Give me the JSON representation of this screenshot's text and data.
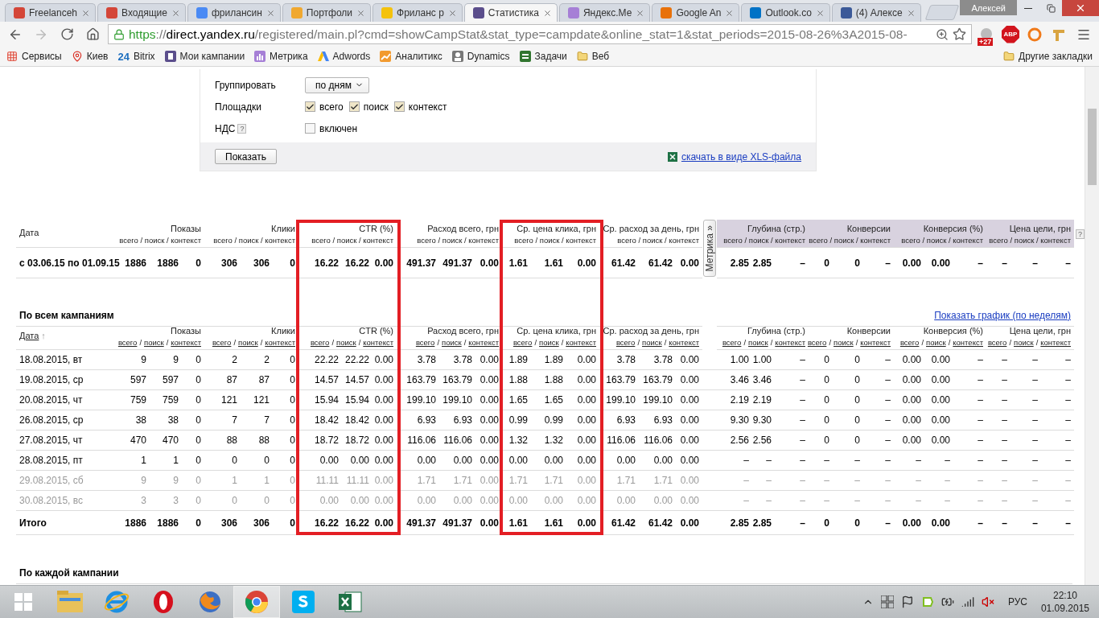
{
  "browser": {
    "tabs": [
      {
        "title": "Freelanceh",
        "selected": false,
        "color": "#d44638"
      },
      {
        "title": "Входящие",
        "selected": false,
        "color": "#d44638"
      },
      {
        "title": "фрилансин",
        "selected": false,
        "color": "#4a8af4"
      },
      {
        "title": "Портфоли",
        "selected": false,
        "color": "#f0a830"
      },
      {
        "title": "Фриланс р",
        "selected": false,
        "color": "#f4c20d"
      },
      {
        "title": "Статистика",
        "selected": true,
        "color": "#5b4e8c"
      },
      {
        "title": "Яндекс.Ме",
        "selected": false,
        "color": "#a67fd6"
      },
      {
        "title": "Google An",
        "selected": false,
        "color": "#e8710a"
      },
      {
        "title": "Outlook.co",
        "selected": false,
        "color": "#0072c6"
      },
      {
        "title": "(4) Алексе",
        "selected": false,
        "color": "#3b5998"
      }
    ],
    "user": "Алексей",
    "address": {
      "scheme": "https",
      "separator": "://",
      "host": "direct.yandex.ru",
      "path": "/registered/main.pl?cmd=showCampStat&stat_type=campdate&online_stat=1&stat_periods=2015-08-26%3A2015-08-"
    },
    "extension_badge": "+27",
    "abp": "ABP",
    "bookmarks": [
      {
        "kind": "apps",
        "label": "Сервисы"
      },
      {
        "kind": "pin",
        "label": "Киев"
      },
      {
        "kind": "bitrix",
        "icon_text": "24",
        "label": "Bitrix"
      },
      {
        "kind": "campaigns",
        "label": "Мои кампании"
      },
      {
        "kind": "metrika",
        "label": "Метрика"
      },
      {
        "kind": "adwords",
        "label": "Adwords"
      },
      {
        "kind": "analytics",
        "label": "Аналитикс"
      },
      {
        "kind": "dynamics",
        "label": "Dynamics"
      },
      {
        "kind": "tasks",
        "label": "Задачи"
      },
      {
        "kind": "folder",
        "label": "Веб"
      }
    ],
    "other_bookmarks": "Другие закладки"
  },
  "form": {
    "rows": [
      {
        "kind": "select",
        "label": "Группировать",
        "value": "по дням"
      },
      {
        "kind": "checkboxes",
        "label": "Площадки",
        "options": [
          {
            "label": "всего",
            "checked": true
          },
          {
            "label": "поиск",
            "checked": true
          },
          {
            "label": "контекст",
            "checked": true
          }
        ]
      },
      {
        "kind": "checkboxes",
        "label": "НДС",
        "help": "?",
        "options": [
          {
            "label": "включен",
            "checked": false
          }
        ]
      }
    ],
    "submit": "Показать",
    "download": "скачать в виде XLS-файла"
  },
  "stats": {
    "summary": {
      "date_heading": "Дата",
      "metrika_tab": "Метрика »",
      "help": "?",
      "columns": [
        {
          "title": "Показы",
          "subtitle": "всего / поиск / контекст",
          "shaded": false
        },
        {
          "title": "Клики",
          "subtitle": "всего / поиск / контекст",
          "shaded": false
        },
        {
          "title": "CTR (%)",
          "subtitle": "всего / поиск / контекст",
          "shaded": false
        },
        {
          "title": "Расход всего, грн",
          "subtitle": "всего / поиск / контекст",
          "shaded": false
        },
        {
          "title": "Ср. цена клика, грн",
          "subtitle": "всего / поиск / контекст",
          "shaded": false
        },
        {
          "title": "Ср. расход за день, грн",
          "subtitle": "всего / поиск / контекст",
          "shaded": false
        },
        {
          "title": "Глубина (стр.)",
          "subtitle": "всего / поиск / контекст",
          "shaded": true
        },
        {
          "title": "Конверсии",
          "subtitle": "всего / поиск / контекст",
          "shaded": true
        },
        {
          "title": "Конверсия (%)",
          "subtitle": "всего / поиск / контекст",
          "shaded": true
        },
        {
          "title": "Цена цели, грн",
          "subtitle": "всего / поиск / контекст",
          "shaded": true
        }
      ],
      "row": {
        "date": "с 03.06.15 по 01.09.15",
        "values": [
          "1886",
          "1886",
          "0",
          "306",
          "306",
          "0",
          "16.22",
          "16.22",
          "0.00",
          "491.37",
          "491.37",
          "0.00",
          "1.61",
          "1.61",
          "0.00",
          "61.42",
          "61.42",
          "0.00",
          "2.85",
          "2.85",
          "–",
          "0",
          "0",
          "–",
          "0.00",
          "0.00",
          "–",
          "–",
          "–",
          "–"
        ]
      }
    },
    "all_campaigns": {
      "title": "По всем кампаниям",
      "chart_link": "Показать график (по неделям)",
      "date_heading": "Дата",
      "sort_arrow": "↑",
      "separator": "/",
      "columns": [
        {
          "title": "Показы",
          "sub": [
            "всего",
            "поиск",
            "контекст"
          ],
          "outlined": false
        },
        {
          "title": "Клики",
          "sub": [
            "всего",
            "поиск",
            "контекст"
          ],
          "outlined": false
        },
        {
          "title": "CTR (%)",
          "sub": [
            "всего",
            "поиск",
            "контекст"
          ],
          "outlined": true
        },
        {
          "title": "Расход всего, грн",
          "sub": [
            "всего",
            "поиск",
            "контекст"
          ],
          "outlined": false
        },
        {
          "title": "Ср. цена клика, грн",
          "sub": [
            "всего",
            "поиск",
            "контекст"
          ],
          "outlined": true
        },
        {
          "title": "Ср. расход за день, грн",
          "sub": [
            "всего",
            "поиск",
            "контекст"
          ],
          "outlined": false
        },
        {
          "title": "Глубина (стр.)",
          "sub": [
            "всего",
            "поиск",
            "контекст"
          ],
          "outlined": false
        },
        {
          "title": "Конверсии",
          "sub": [
            "всего",
            "поиск",
            "контекст"
          ],
          "outlined": false
        },
        {
          "title": "Конверсия (%)",
          "sub": [
            "всего",
            "поиск",
            "контекст"
          ],
          "outlined": false
        },
        {
          "title": "Цена цели, грн",
          "sub": [
            "всего",
            "поиск",
            "контекст"
          ],
          "outlined": false
        }
      ],
      "rows": [
        {
          "date": "18.08.2015, вт",
          "dimmed": false,
          "values": [
            "9",
            "9",
            "0",
            "2",
            "2",
            "0",
            "22.22",
            "22.22",
            "0.00",
            "3.78",
            "3.78",
            "0.00",
            "1.89",
            "1.89",
            "0.00",
            "3.78",
            "3.78",
            "0.00",
            "1.00",
            "1.00",
            "–",
            "0",
            "0",
            "–",
            "0.00",
            "0.00",
            "–",
            "–",
            "–",
            "–"
          ]
        },
        {
          "date": "19.08.2015, ср",
          "dimmed": false,
          "values": [
            "597",
            "597",
            "0",
            "87",
            "87",
            "0",
            "14.57",
            "14.57",
            "0.00",
            "163.79",
            "163.79",
            "0.00",
            "1.88",
            "1.88",
            "0.00",
            "163.79",
            "163.79",
            "0.00",
            "3.46",
            "3.46",
            "–",
            "0",
            "0",
            "–",
            "0.00",
            "0.00",
            "–",
            "–",
            "–",
            "–"
          ]
        },
        {
          "date": "20.08.2015, чт",
          "dimmed": false,
          "values": [
            "759",
            "759",
            "0",
            "121",
            "121",
            "0",
            "15.94",
            "15.94",
            "0.00",
            "199.10",
            "199.10",
            "0.00",
            "1.65",
            "1.65",
            "0.00",
            "199.10",
            "199.10",
            "0.00",
            "2.19",
            "2.19",
            "–",
            "0",
            "0",
            "–",
            "0.00",
            "0.00",
            "–",
            "–",
            "–",
            "–"
          ]
        },
        {
          "date": "26.08.2015, ср",
          "dimmed": false,
          "values": [
            "38",
            "38",
            "0",
            "7",
            "7",
            "0",
            "18.42",
            "18.42",
            "0.00",
            "6.93",
            "6.93",
            "0.00",
            "0.99",
            "0.99",
            "0.00",
            "6.93",
            "6.93",
            "0.00",
            "9.30",
            "9.30",
            "–",
            "0",
            "0",
            "–",
            "0.00",
            "0.00",
            "–",
            "–",
            "–",
            "–"
          ]
        },
        {
          "date": "27.08.2015, чт",
          "dimmed": false,
          "values": [
            "470",
            "470",
            "0",
            "88",
            "88",
            "0",
            "18.72",
            "18.72",
            "0.00",
            "116.06",
            "116.06",
            "0.00",
            "1.32",
            "1.32",
            "0.00",
            "116.06",
            "116.06",
            "0.00",
            "2.56",
            "2.56",
            "–",
            "0",
            "0",
            "–",
            "0.00",
            "0.00",
            "–",
            "–",
            "–",
            "–"
          ]
        },
        {
          "date": "28.08.2015, пт",
          "dimmed": false,
          "values": [
            "1",
            "1",
            "0",
            "0",
            "0",
            "0",
            "0.00",
            "0.00",
            "0.00",
            "0.00",
            "0.00",
            "0.00",
            "0.00",
            "0.00",
            "0.00",
            "0.00",
            "0.00",
            "0.00",
            "–",
            "–",
            "–",
            "–",
            "–",
            "–",
            "–",
            "–",
            "–",
            "–",
            "–",
            "–"
          ]
        },
        {
          "date": "29.08.2015, сб",
          "dimmed": true,
          "values": [
            "9",
            "9",
            "0",
            "1",
            "1",
            "0",
            "11.11",
            "11.11",
            "0.00",
            "1.71",
            "1.71",
            "0.00",
            "1.71",
            "1.71",
            "0.00",
            "1.71",
            "1.71",
            "0.00",
            "–",
            "–",
            "–",
            "–",
            "–",
            "–",
            "–",
            "–",
            "–",
            "–",
            "–",
            "–"
          ]
        },
        {
          "date": "30.08.2015, вс",
          "dimmed": true,
          "values": [
            "3",
            "3",
            "0",
            "0",
            "0",
            "0",
            "0.00",
            "0.00",
            "0.00",
            "0.00",
            "0.00",
            "0.00",
            "0.00",
            "0.00",
            "0.00",
            "0.00",
            "0.00",
            "0.00",
            "–",
            "–",
            "–",
            "–",
            "–",
            "–",
            "–",
            "–",
            "–",
            "–",
            "–",
            "–"
          ]
        }
      ],
      "total": {
        "label": "Итого",
        "values": [
          "1886",
          "1886",
          "0",
          "306",
          "306",
          "0",
          "16.22",
          "16.22",
          "0.00",
          "491.37",
          "491.37",
          "0.00",
          "1.61",
          "1.61",
          "0.00",
          "61.42",
          "61.42",
          "0.00",
          "2.85",
          "2.85",
          "–",
          "0",
          "0",
          "–",
          "0.00",
          "0.00",
          "–",
          "–",
          "–",
          "–"
        ]
      }
    },
    "per_campaign_title": "По каждой кампании"
  },
  "taskbar": {
    "apps": [
      {
        "kind": "explorer",
        "selected": false
      },
      {
        "kind": "ie",
        "selected": false
      },
      {
        "kind": "opera",
        "selected": false
      },
      {
        "kind": "firefox",
        "selected": false
      },
      {
        "kind": "chrome",
        "selected": true
      },
      {
        "kind": "skype",
        "selected": false
      },
      {
        "kind": "excel",
        "selected": false
      }
    ],
    "language": "РУС",
    "time": "22:10",
    "date": "01.09.2015"
  }
}
